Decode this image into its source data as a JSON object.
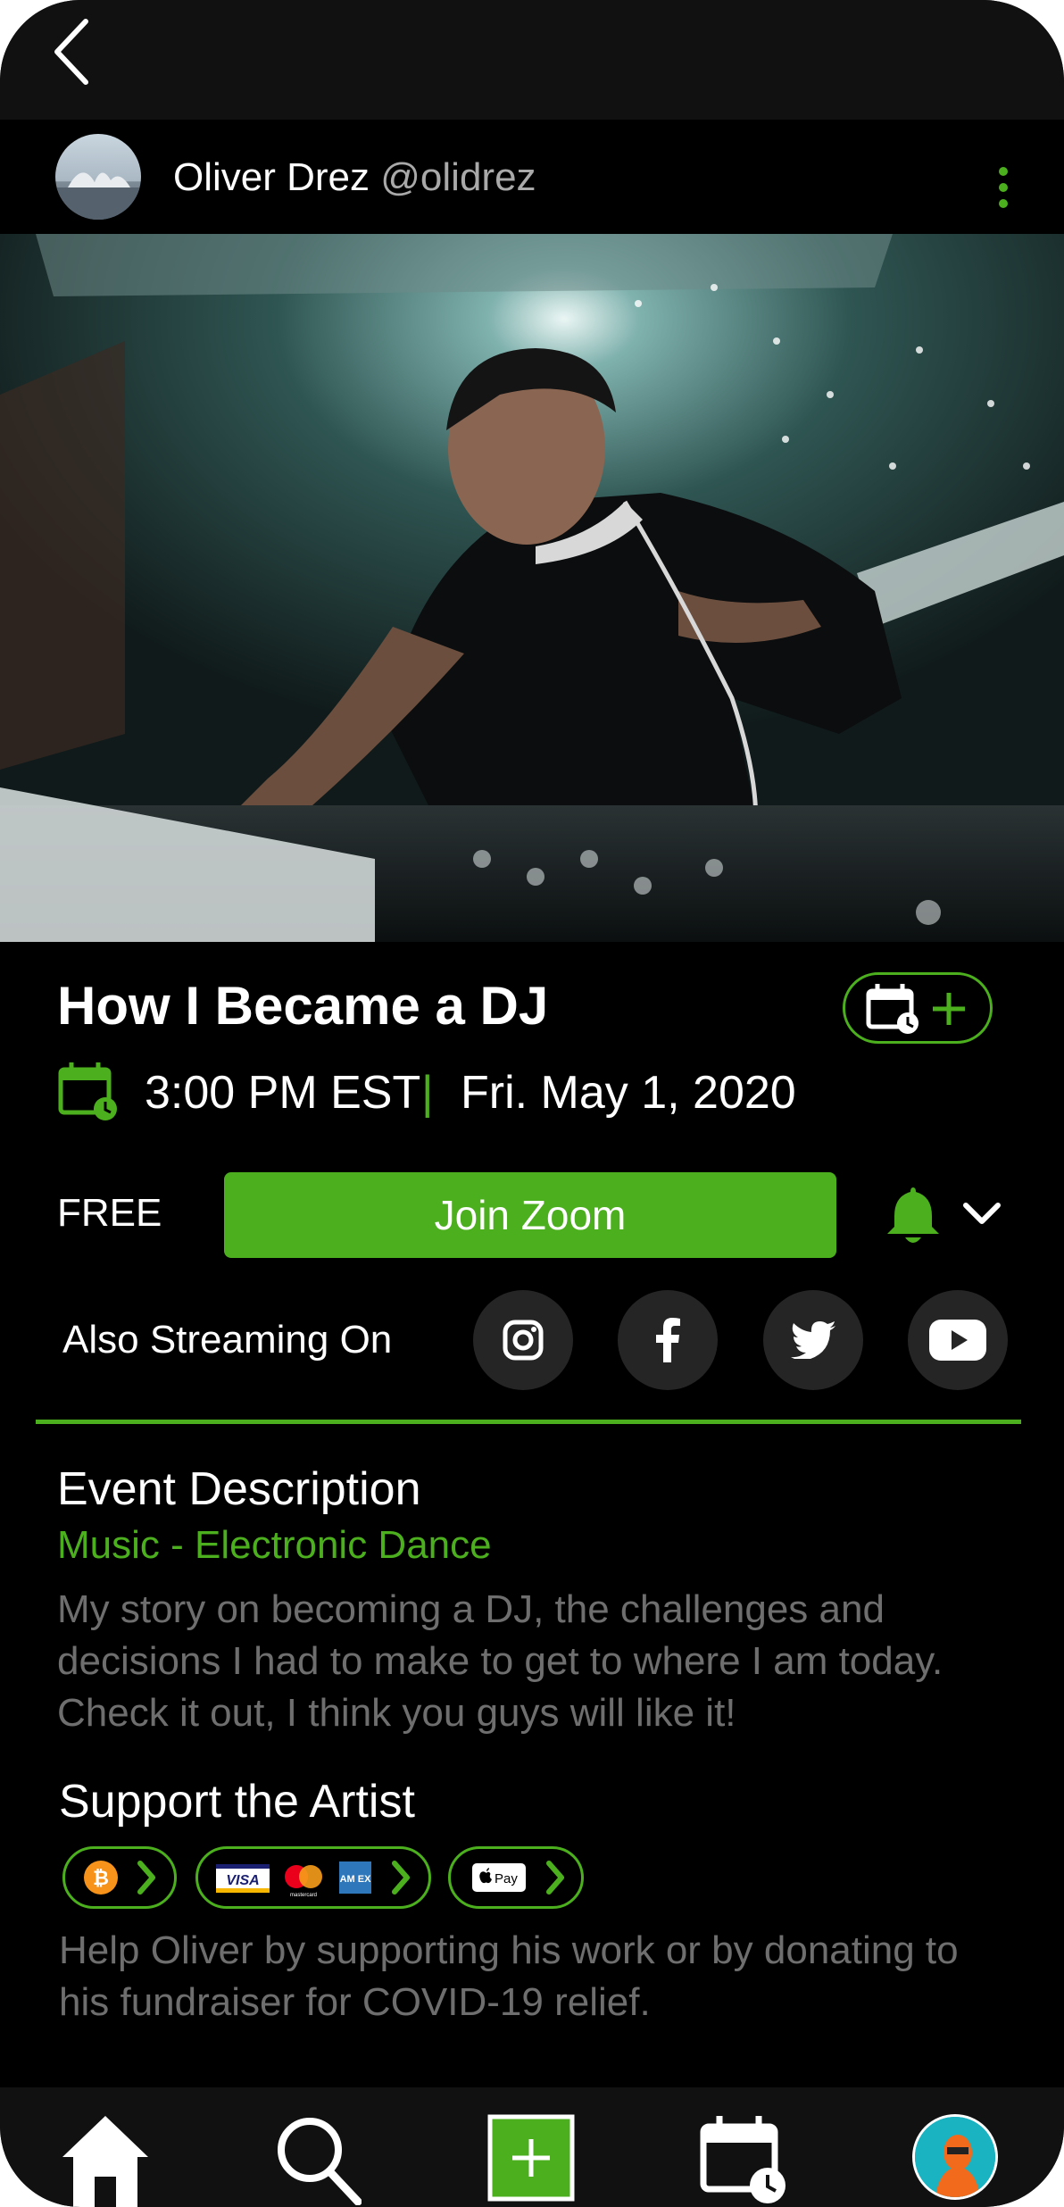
{
  "header": {
    "user_name": "Oliver Drez",
    "user_handle": "@olidrez"
  },
  "event": {
    "title": "How I Became a DJ",
    "time": "3:00 PM EST",
    "separator": "|",
    "date": "Fri. May 1, 2020",
    "price": "FREE",
    "join_label": "Join Zoom"
  },
  "streaming": {
    "label": "Also Streaming On",
    "platforms": [
      "instagram-icon",
      "facebook-icon",
      "twitter-icon",
      "youtube-icon"
    ]
  },
  "description": {
    "heading": "Event Description",
    "category": "Music - Electronic Dance",
    "text": "My story on becoming a DJ, the challenges and decisions I had to make to get to where I am today. Check it out, I think you guys will like it!"
  },
  "support": {
    "heading": "Support the Artist",
    "methods": [
      "bitcoin",
      "cards",
      "apple-pay"
    ],
    "card_brands": {
      "visa": "VISA",
      "amex": "AM EX",
      "mastercard": "mastercard",
      "applepay": "Pay"
    },
    "text": "Help Oliver by supporting his work or by donating to his fundraiser for COVID-19 relief."
  },
  "navbar": {
    "items": [
      "home-icon",
      "search-icon",
      "add-icon",
      "calendar-icon",
      "profile-avatar"
    ]
  },
  "colors": {
    "accent": "#4caf1d",
    "background": "#000000",
    "muted_text": "#6e6e6e",
    "handle_text": "#a9a9a9"
  }
}
